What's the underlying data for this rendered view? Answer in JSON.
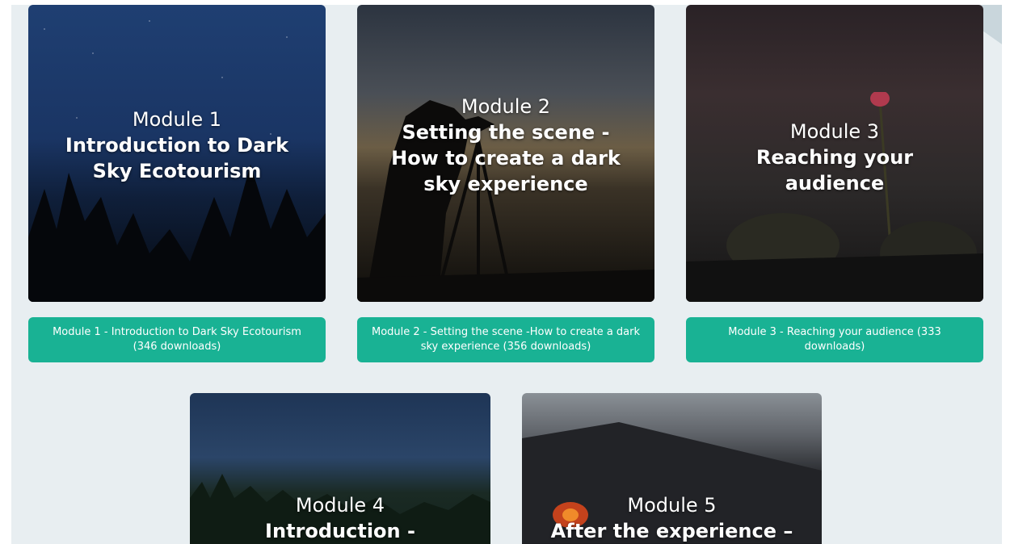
{
  "modules": [
    {
      "number": "Module 1",
      "name": "Introduction to Dark Sky Ecotourism",
      "download_label": "Module 1 - Introduction to Dark Sky Ecotourism (346 downloads)"
    },
    {
      "number": "Module 2",
      "name": "Setting the scene -How to create a dark sky experience",
      "download_label": "Module 2 - Setting the scene -How to create a dark sky experience (356 downloads)"
    },
    {
      "number": "Module 3",
      "name": "Reaching your audience",
      "download_label": "Module 3 - Reaching your audience (333 downloads)"
    },
    {
      "number": "Module 4",
      "name": "Introduction - Designing"
    },
    {
      "number": "Module 5",
      "name": "After the experience – A"
    }
  ],
  "colors": {
    "page_background": "#e8eef1",
    "download_button": "#19b294",
    "button_text": "#ffffff",
    "title_text": "#ffffff"
  }
}
